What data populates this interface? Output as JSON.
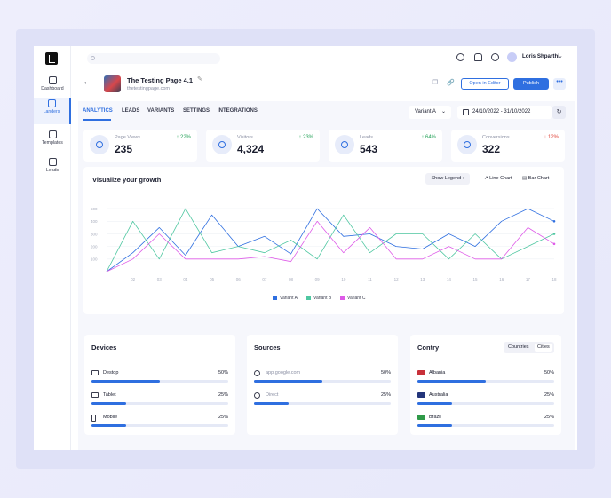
{
  "sidebar": {
    "items": [
      {
        "label": "Dashboard",
        "icon": "dashboard-icon"
      },
      {
        "label": "Landers",
        "icon": "landers-icon"
      },
      {
        "label": "Templates",
        "icon": "templates-icon"
      },
      {
        "label": "Leads",
        "icon": "leads-icon"
      }
    ]
  },
  "topbar": {
    "user_name": "Loris Shparthi"
  },
  "page": {
    "title": "The Testing Page 4.1",
    "url": "thetestingpage.com",
    "open_editor_label": "Open in Editor",
    "publish_label": "Publish",
    "more_label": "•••"
  },
  "tabs": [
    {
      "label": "ANALYTICS"
    },
    {
      "label": "LEADS"
    },
    {
      "label": "VARIANTS"
    },
    {
      "label": "SETTINGS"
    },
    {
      "label": "INTEGRATIONS"
    }
  ],
  "filters": {
    "variant": "Variant A",
    "date_range": "24/10/2022  -  31/10/2022"
  },
  "stats": [
    {
      "label": "Page Views",
      "value": "235",
      "change": "↑ 22%",
      "trend": "up"
    },
    {
      "label": "Visitors",
      "value": "4,324",
      "change": "↑ 23%",
      "trend": "up"
    },
    {
      "label": "Leads",
      "value": "543",
      "change": "↑ 64%",
      "trend": "up"
    },
    {
      "label": "Conversions",
      "value": "322",
      "change": "↓ 12%",
      "trend": "down"
    }
  ],
  "chart": {
    "title": "Visualize your growth",
    "show_legend_label": "Show Legend",
    "line_chart_label": "Line Chart",
    "bar_chart_label": "Bar Chart"
  },
  "chart_data": {
    "type": "line",
    "x": [
      "01",
      "02",
      "03",
      "04",
      "05",
      "06",
      "07",
      "08",
      "09",
      "10",
      "11",
      "12",
      "13",
      "14",
      "15",
      "16",
      "17",
      "18"
    ],
    "y_ticks": [
      100,
      200,
      300,
      400,
      500
    ],
    "ylim": [
      0,
      550
    ],
    "grid": true,
    "legend": "bottom-center",
    "series": [
      {
        "name": "Variant A",
        "color": "#2f6fe0",
        "values": [
          0,
          150,
          350,
          130,
          450,
          200,
          280,
          140,
          500,
          280,
          300,
          200,
          180,
          300,
          200,
          400,
          500,
          400
        ]
      },
      {
        "name": "Variant B",
        "color": "#4fc7a1",
        "values": [
          0,
          400,
          100,
          500,
          150,
          200,
          150,
          250,
          100,
          450,
          150,
          300,
          300,
          100,
          300,
          100,
          200,
          300
        ]
      },
      {
        "name": "Variant C",
        "color": "#de5be8",
        "values": [
          0,
          100,
          300,
          100,
          100,
          100,
          120,
          80,
          400,
          150,
          350,
          100,
          100,
          200,
          100,
          100,
          350,
          220
        ]
      }
    ]
  },
  "devices": {
    "title": "Devices",
    "rows": [
      {
        "label": "Destop",
        "pct": "50%",
        "value": 50
      },
      {
        "label": "Tablet",
        "pct": "25%",
        "value": 25
      },
      {
        "label": "Mobile",
        "pct": "25%",
        "value": 25
      }
    ]
  },
  "sources": {
    "title": "Sources",
    "rows": [
      {
        "label": "app.google.com",
        "pct": "50%",
        "value": 50
      },
      {
        "label": "Direct",
        "pct": "25%",
        "value": 25
      }
    ]
  },
  "country": {
    "title": "Contry",
    "tabs": [
      "Countries",
      "Cities"
    ],
    "rows": [
      {
        "label": "Albania",
        "pct": "50%",
        "value": 50,
        "flag_color": "#c8303a"
      },
      {
        "label": "Australia",
        "pct": "25%",
        "value": 25,
        "flag_color": "#23357a"
      },
      {
        "label": "Brazil",
        "pct": "25%",
        "value": 25,
        "flag_color": "#2f9a48"
      }
    ]
  },
  "colors": {
    "accent": "#2f6fe0",
    "up": "#27a35a",
    "down": "#e0443a"
  }
}
